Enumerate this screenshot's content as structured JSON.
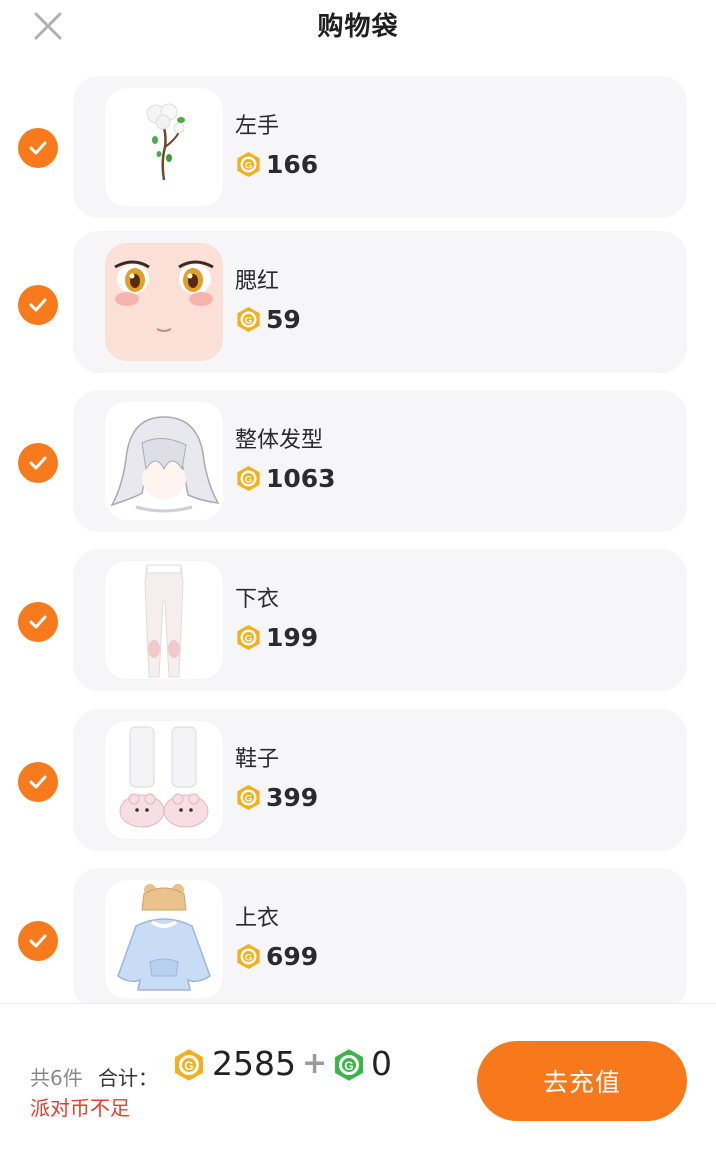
{
  "header": {
    "title": "购物袋",
    "close_icon": "close-icon"
  },
  "items": [
    {
      "name": "左手",
      "price": "166"
    },
    {
      "name": "腮红",
      "price": "59"
    },
    {
      "name": "整体发型",
      "price": "1063"
    },
    {
      "name": "下衣",
      "price": "199"
    },
    {
      "name": "鞋子",
      "price": "399"
    },
    {
      "name": "上衣",
      "price": "699"
    }
  ],
  "footer": {
    "count": "共6件",
    "total_label": "合计：",
    "total_coins": "2585",
    "plus": "+",
    "green_coins": "0",
    "warning": "派对币不足",
    "recharge_label": "去充值"
  },
  "colors": {
    "accent": "#f7791b",
    "coin": "#f2b01e",
    "green_coin": "#3bb54a",
    "warning": "#e83c2c",
    "card_bg": "#f6f6f8"
  }
}
